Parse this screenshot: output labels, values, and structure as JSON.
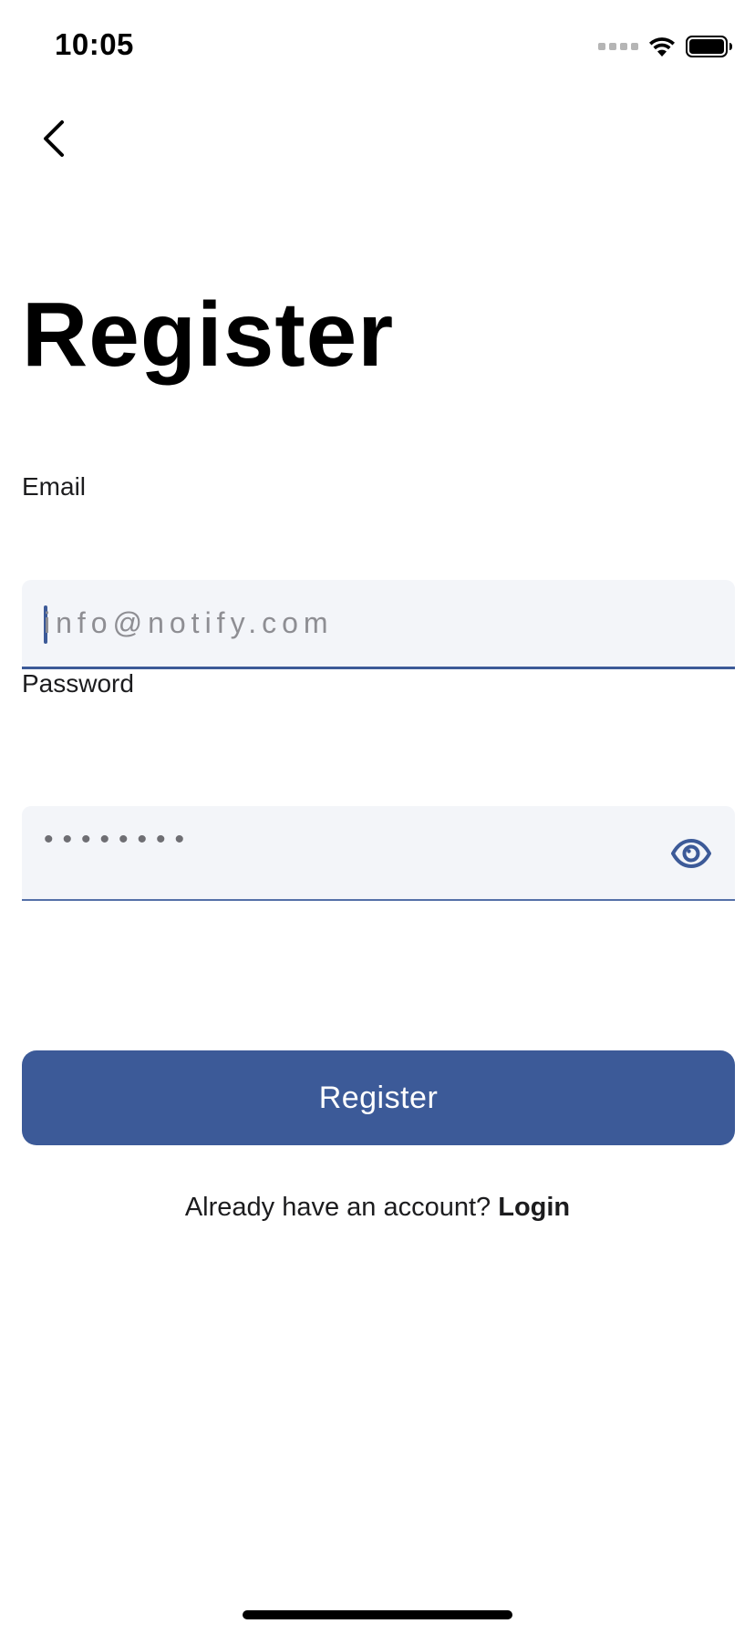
{
  "status_bar": {
    "time": "10:05"
  },
  "nav": {
    "back_icon": "chevron-left-icon"
  },
  "title": "Register",
  "email": {
    "label": "Email",
    "placeholder": "info@notify.com",
    "value": ""
  },
  "password": {
    "label": "Password",
    "masked_value": "••••••••",
    "toggle_icon": "eye-icon"
  },
  "register_button": {
    "label": "Register"
  },
  "login_prompt": {
    "text": "Already have an account? ",
    "link_label": "Login"
  },
  "colors": {
    "accent": "#3c5a98",
    "field_background": "#f3f5f9",
    "text": "#000000",
    "placeholder": "#8e8e93"
  }
}
